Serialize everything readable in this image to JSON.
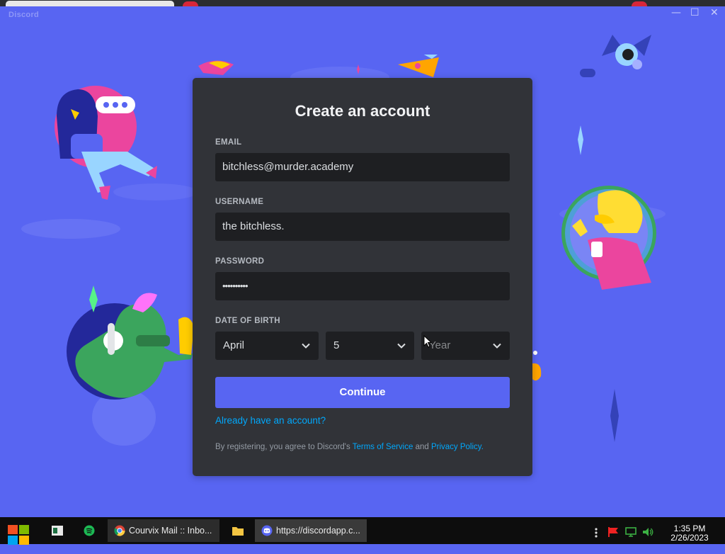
{
  "window": {
    "app_name": "Discord",
    "controls": {
      "minimize": "—",
      "maximize": "☐",
      "close": "✕"
    }
  },
  "form": {
    "title": "Create an account",
    "email": {
      "label": "EMAIL",
      "value": "bitchless@murder.academy"
    },
    "username": {
      "label": "USERNAME",
      "value": "the bitchless."
    },
    "password": {
      "label": "PASSWORD",
      "value": "••••••••••"
    },
    "dob": {
      "label": "DATE OF BIRTH",
      "month": "April",
      "day": "5",
      "year_placeholder": "Year"
    },
    "continue_label": "Continue",
    "login_link": "Already have an account?",
    "terms": {
      "prefix": "By registering, you agree to Discord's ",
      "tos": "Terms of Service",
      "and": " and ",
      "privacy": "Privacy Policy",
      "suffix": "."
    }
  },
  "taskbar": {
    "tasks": [
      {
        "label": "Courvix Mail :: Inbo...",
        "icon": "chrome-icon"
      },
      {
        "label": "https://discordapp.c...",
        "icon": "discord-icon"
      }
    ],
    "clock": {
      "time": "1:35 PM",
      "date": "2/26/2023"
    }
  },
  "colors": {
    "brand": "#5865f2",
    "modal_bg": "#313338",
    "input_bg": "#1e1f22",
    "link": "#00a8fc",
    "taskbar_bg": "#0d0d0d"
  }
}
